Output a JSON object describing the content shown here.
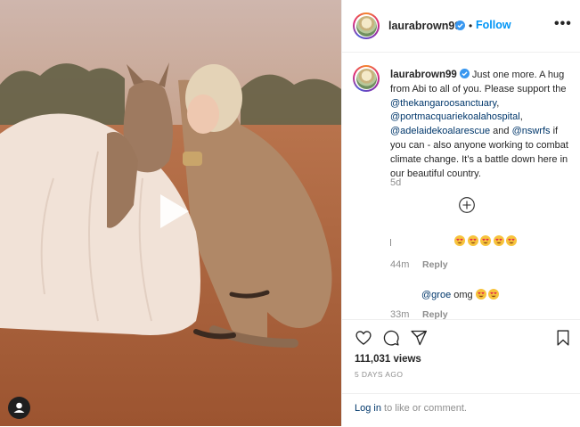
{
  "post": {
    "username": "laurabrown99",
    "follow_label": "Follow",
    "separator": "•",
    "more_label": "•••"
  },
  "caption": {
    "username": "laurabrown99",
    "text_intro": "Just one more. A hug from Abi to all of you. Please support the",
    "mentions": [
      "@thekangaroosanctuary",
      "@portmacquariekoalahospital",
      "@adelaidekoalarescue",
      "@nswrfs"
    ],
    "sep1": ",",
    "sep2": ",",
    "and": "and",
    "text_outro": "if you can - also anyone working to combat climate change. It’s a battle down here in our beautiful country.",
    "age": "5d"
  },
  "comments": [
    {
      "time": "44m",
      "reply_label": "Reply",
      "emoji_count": 5
    },
    {
      "mention": "@groe",
      "text": "omg",
      "time": "33m",
      "reply_label": "Reply",
      "emoji_count": 2
    }
  ],
  "stats": {
    "views": "111,031 views",
    "date": "5 DAYS AGO"
  },
  "login": {
    "link": "Log in",
    "rest": "to like or comment."
  },
  "icons": {
    "verified": "verified-badge-icon",
    "like": "heart-icon",
    "comment": "comment-bubble-icon",
    "share": "paper-plane-icon",
    "save": "bookmark-icon",
    "play": "play-icon",
    "tag": "user-tag-icon",
    "load": "plus-circle-icon"
  },
  "colors": {
    "accent": "#0095f6",
    "mention": "#00376b",
    "muted": "#8e8e8e",
    "verified": "#3897f0"
  }
}
